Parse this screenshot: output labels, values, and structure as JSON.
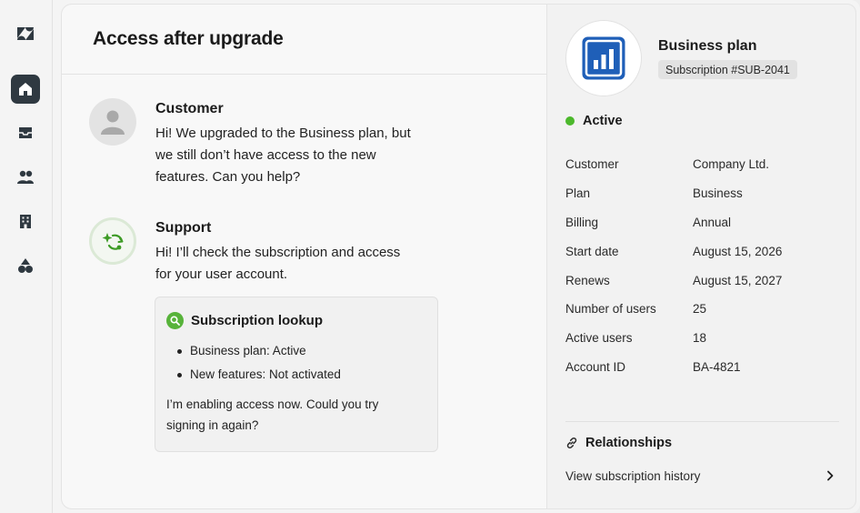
{
  "sidebar": {
    "items": [
      {
        "name": "home",
        "icon": "home-icon",
        "active": true
      },
      {
        "name": "inbox",
        "icon": "inbox-icon",
        "active": false
      },
      {
        "name": "users",
        "icon": "users-icon",
        "active": false
      },
      {
        "name": "organizations",
        "icon": "building-icon",
        "active": false
      },
      {
        "name": "apps",
        "icon": "shapes-icon",
        "active": false
      }
    ]
  },
  "ticket": {
    "title": "Access after upgrade",
    "messages": [
      {
        "author": "Customer",
        "text": "Hi! We upgraded to the Business plan, but we still don’t have access to the new features. Can you help?"
      },
      {
        "author": "Support",
        "text": "Hi! I’ll check the subscription and access for your user account."
      }
    ],
    "lookup": {
      "title": "Subscription lookup",
      "items": [
        "Business plan: Active",
        "New features: Not activated"
      ],
      "note": "I’m enabling access now. Could you try signing in again?"
    }
  },
  "panel": {
    "plan_title": "Business plan",
    "subscription_badge": "Subscription #SUB-2041",
    "status": "Active",
    "details": [
      {
        "label": "Customer",
        "value": "Company Ltd."
      },
      {
        "label": "Plan",
        "value": "Business"
      },
      {
        "label": "Billing",
        "value": "Annual"
      },
      {
        "label": "Start date",
        "value": "August 15, 2026"
      },
      {
        "label": "Renews",
        "value": "August 15, 2027"
      },
      {
        "label": "Number of users",
        "value": "25"
      },
      {
        "label": "Active users",
        "value": "18"
      },
      {
        "label": "Account ID",
        "value": "BA-4821"
      }
    ],
    "relationships_title": "Relationships",
    "history_link": "View subscription history"
  },
  "colors": {
    "accent_dark": "#2f3941",
    "status_green": "#4cb82c",
    "plan_logo_blue": "#1f5fb8"
  }
}
